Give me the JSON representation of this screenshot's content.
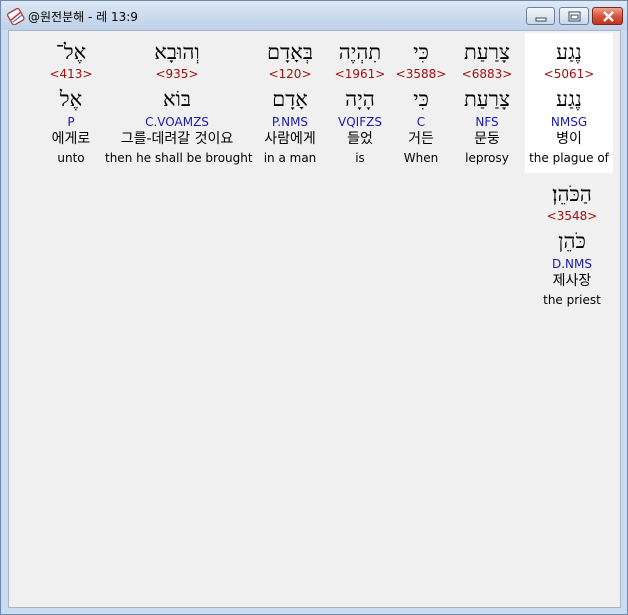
{
  "window": {
    "title": "@원전분해 - 레 13:9",
    "buttons": {
      "minimize": "minimize-icon",
      "maximize": "maximize-icon",
      "close": "close-icon"
    },
    "colors": {
      "strong": "#a01010",
      "morph": "#1a1ab0"
    }
  },
  "words": [
    {
      "inflected": "נֶגַע",
      "strong": "<5061>",
      "lemma": "נֶגַע",
      "morph": "NMSG",
      "korean": "병이",
      "english": "the plague of"
    },
    {
      "inflected": "צָרַעַת",
      "strong": "<6883>",
      "lemma": "צָרַעַת",
      "morph": "NFS",
      "korean": "문둥",
      "english": "leprosy"
    },
    {
      "inflected": "כִּי",
      "strong": "<3588>",
      "lemma": "כִּי",
      "morph": "C",
      "korean": "거든",
      "english": "When"
    },
    {
      "inflected": "תִהְיֶה",
      "strong": "<1961>",
      "lemma": "הָיָה",
      "morph": "VQIFZS",
      "korean": "들었",
      "english": "is"
    },
    {
      "inflected": "בְּאָדָם",
      "strong": "<120>",
      "lemma": "אָדָם",
      "morph": "P.NMS",
      "korean": "사람에게",
      "english": "in a man"
    },
    {
      "inflected": "וְהוּבָא",
      "strong": "<935>",
      "lemma": "בּוֹא",
      "morph": "C.VOAMZS",
      "korean": "그를-데려갈 것이요",
      "english": "then he shall be brought"
    },
    {
      "inflected": "אֶל־",
      "strong": "<413>",
      "lemma": "אֶל",
      "morph": "P",
      "korean": "에게로",
      "english": "unto"
    },
    {
      "inflected": "הַכֹּהֵן׃",
      "strong": "<3548>",
      "lemma": "כֹּהֵן",
      "morph": "D.NMS",
      "korean": "제사장",
      "english": "the priest"
    }
  ]
}
